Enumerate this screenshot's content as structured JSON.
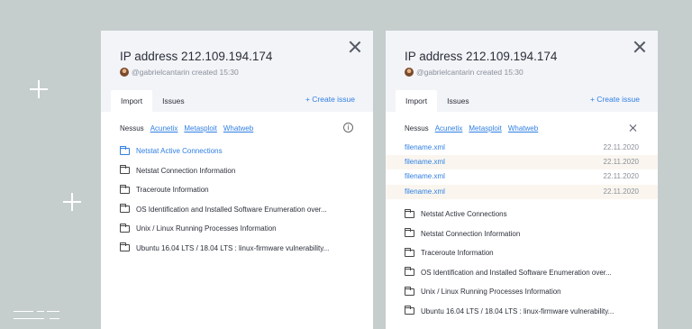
{
  "left_panel": {
    "title": "IP address 212.109.194.174",
    "author": "@gabrielcantarin",
    "created": "created 15:30",
    "tabs": [
      {
        "label": "Import"
      },
      {
        "label": "Issues"
      }
    ],
    "create_issue": "+ Create issue",
    "filter_label": "Nessus",
    "filters": [
      "Acunetix",
      "Metasploit",
      "Whatweb"
    ],
    "info_icon": "i",
    "items": [
      {
        "label": "Netstat Active Connections",
        "highlighted": true
      },
      {
        "label": "Netstat Connection Information"
      },
      {
        "label": "Traceroute Information"
      },
      {
        "label": "OS Identification and Installed Software Enumeration over..."
      },
      {
        "label": "Unix / Linux Running Processes Information"
      },
      {
        "label": "Ubuntu 16.04 LTS / 18.04 LTS : linux-firmware vulnerability..."
      }
    ]
  },
  "right_panel": {
    "title": "IP address 212.109.194.174",
    "author": "@gabrielcantarin",
    "created": "created 15:30",
    "tabs": [
      {
        "label": "Import"
      },
      {
        "label": "Issues"
      }
    ],
    "create_issue": "+ Create issue",
    "filter_label": "Nessus",
    "filters": [
      "Acunetix",
      "Metasploit",
      "Whatweb"
    ],
    "files": [
      {
        "name": "filename.xml",
        "date": "22.11.2020"
      },
      {
        "name": "filename.xml",
        "date": "22.11.2020"
      },
      {
        "name": "filename.xml",
        "date": "22.11.2020"
      },
      {
        "name": "filename.xml",
        "date": "22.11.2020"
      }
    ],
    "items": [
      {
        "label": "Netstat Active Connections"
      },
      {
        "label": "Netstat Connection Information"
      },
      {
        "label": "Traceroute Information"
      },
      {
        "label": "OS Identification and Installed Software Enumeration over..."
      },
      {
        "label": "Unix / Linux Running Processes Information"
      },
      {
        "label": "Ubuntu 16.04 LTS / 18.04 LTS : linux-firmware vulnerability..."
      }
    ]
  },
  "colors": {
    "background": "#c5cdcd",
    "accent": "#2f7fe3",
    "panel_header": "#f3f4f8"
  }
}
